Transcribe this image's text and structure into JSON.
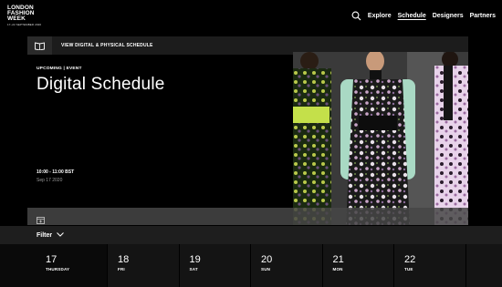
{
  "brand": {
    "line1": "LONDON",
    "line2": "FASHION",
    "line3": "WEEK",
    "dates": "17–22 SEPTEMBER 2020"
  },
  "nav": {
    "items": [
      {
        "label": "Explore",
        "active": false
      },
      {
        "label": "Schedule",
        "active": true
      },
      {
        "label": "Designers",
        "active": false
      },
      {
        "label": "Partners",
        "active": false
      }
    ]
  },
  "hero": {
    "bar_label": "VIEW DIGITAL & PHYSICAL SCHEDULE",
    "eyebrow": "UPCOMING | EVENT",
    "title": "Digital Schedule",
    "time": "10:00 - 11:00 BST",
    "date": "Sep 17 2020"
  },
  "filter": {
    "label": "Filter"
  },
  "days": [
    {
      "num": "17",
      "dow": "THURSDAY",
      "selected": true
    },
    {
      "num": "18",
      "dow": "FRI",
      "selected": false
    },
    {
      "num": "19",
      "dow": "SAT",
      "selected": false
    },
    {
      "num": "20",
      "dow": "SUN",
      "selected": false
    },
    {
      "num": "21",
      "dow": "MON",
      "selected": false
    },
    {
      "num": "22",
      "dow": "TUE",
      "selected": false
    }
  ],
  "colors": {
    "background": "#000000",
    "bar": "#1c1c1c",
    "filter_bar": "#1e1e1e",
    "date_strip": "#141414"
  }
}
